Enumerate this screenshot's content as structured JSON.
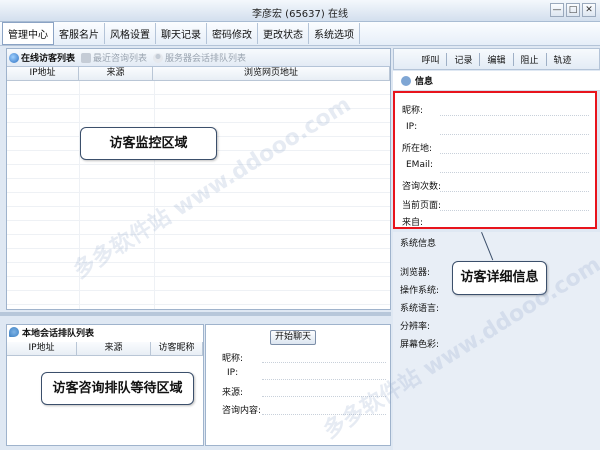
{
  "window": {
    "title": "李彦宏 (65637) 在线",
    "controls": [
      "—",
      "□",
      "✕"
    ]
  },
  "menu": {
    "items": [
      "管理中心",
      "客服名片",
      "风格设置",
      "聊天记录",
      "密码修改",
      "更改状态",
      "系统选项"
    ]
  },
  "visitor_panel": {
    "tabs": {
      "online": "在线访客列表",
      "history": "最近咨询列表",
      "queue": "服务器会话排队列表"
    },
    "columns": [
      "IP地址",
      "来源",
      "浏览网页地址"
    ],
    "callout": "访客监控区域"
  },
  "queue_panel": {
    "title": "本地会话排队列表",
    "columns": [
      "IP地址",
      "来源",
      "访客昵称"
    ],
    "callout": "访客咨询排队等待区域"
  },
  "detail_panel": {
    "start_chat": "开始聊天",
    "fields": [
      "昵称:",
      "IP:",
      "来源:",
      "咨询内容:"
    ]
  },
  "right_panel": {
    "toolbar": [
      "呼叫",
      "记录",
      "编辑",
      "阻止",
      "轨迹"
    ],
    "info_title": "信息",
    "info_fields": [
      "昵称:",
      "IP:",
      "所在地:",
      "EMail:",
      "咨询次数:",
      "当前页面:",
      "来自:"
    ],
    "system_title": "系统信息",
    "system_fields": [
      "浏览器:",
      "操作系统:",
      "系统语言:",
      "分辨率:",
      "屏幕色彩:"
    ],
    "callout": "访客详细信息"
  },
  "watermark": "多多软件站 www.ddooo.com",
  "colors": {
    "highlight_box": "#e8141c",
    "frame": "#9fb3cc"
  }
}
